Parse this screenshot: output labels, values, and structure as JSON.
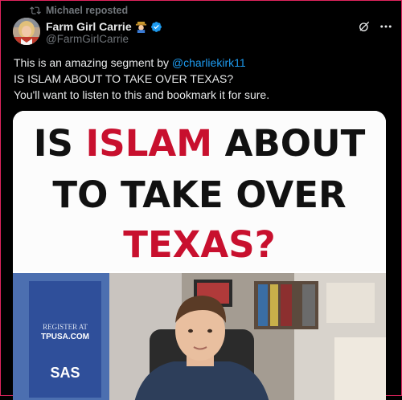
{
  "repost": {
    "text": "Michael reposted",
    "icon": "repost-icon"
  },
  "author": {
    "display_name": "Farm Girl Carrie",
    "handle": "@FarmGirlCarrie",
    "badge_icon": "farmer-emoji-icon",
    "verified_icon": "verified-badge-icon",
    "verified_color": "#1d9bf0"
  },
  "actions": {
    "grok_icon": "grok-icon",
    "more_icon": "more-icon"
  },
  "tweet": {
    "line1_prefix": "This is an amazing segment by ",
    "line1_mention": "@charliekirk11",
    "line2": "IS ISLAM ABOUT TO TAKE OVER TEXAS?",
    "line3": "You'll want to listen to this and bookmark it for sure."
  },
  "media": {
    "headline_line1_red": "ISLAM",
    "headline_line1_pre": "IS ",
    "headline_line1_post": " ABOUT",
    "headline_line2": "TO TAKE OVER",
    "headline_line3_red": "TEXAS?",
    "banner_text_1": "REGISTER AT",
    "banner_text_2": "TPUSA.COM",
    "banner_text_3": "SAS",
    "accent_red": "#c8102e"
  }
}
